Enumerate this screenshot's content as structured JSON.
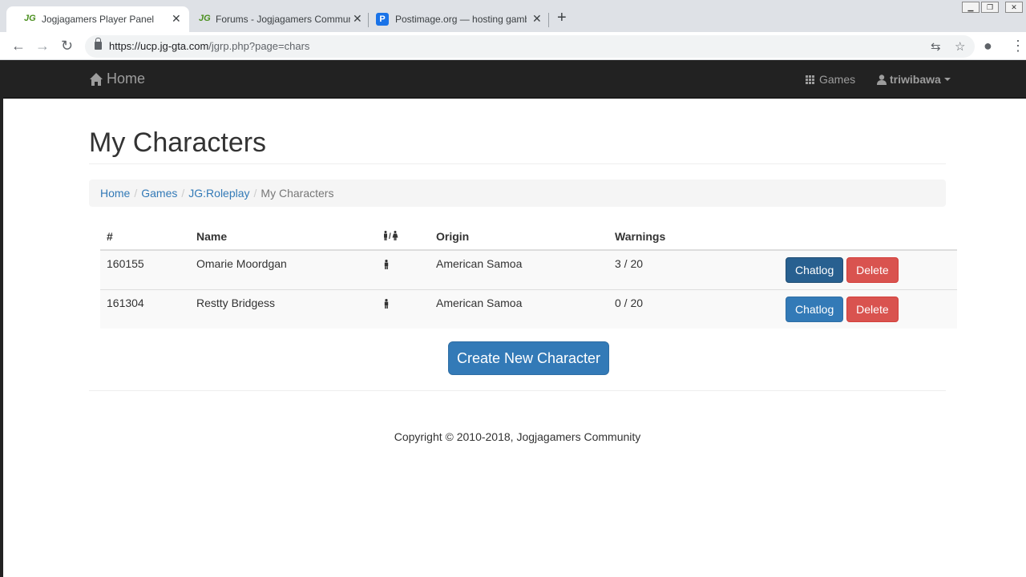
{
  "browser": {
    "tabs": [
      {
        "title": "Jogjagamers Player Panel",
        "favicon": "JG",
        "active": true
      },
      {
        "title": "Forums - Jogjagamers Communi",
        "favicon": "JG",
        "active": false
      },
      {
        "title": "Postimage.org — hosting gamba",
        "favicon": "P",
        "active": false
      }
    ],
    "url_host": "https://ucp.jg-gta.com",
    "url_path": "/jgrp.php?page=chars",
    "icons": [
      "back-arrow-icon",
      "forward-arrow-icon",
      "reload-icon",
      "translate-icon",
      "star-icon",
      "account-icon",
      "menu-icon"
    ]
  },
  "navbar": {
    "home_label": "Home",
    "games_label": "Games",
    "user_label": "triwibawa"
  },
  "page": {
    "title": "My Characters",
    "breadcrumb": [
      "Home",
      "Games",
      "JG:Roleplay",
      "My Characters"
    ]
  },
  "table": {
    "headers": {
      "id": "#",
      "name": "Name",
      "gender": "♂/♀",
      "origin": "Origin",
      "warnings": "Warnings"
    },
    "rows": [
      {
        "id": "160155",
        "name": "Omarie Moordgan",
        "gender": "male",
        "origin": "American Samoa",
        "warnings": "3 / 20"
      },
      {
        "id": "161304",
        "name": "Restty Bridgess",
        "gender": "male",
        "origin": "American Samoa",
        "warnings": "0 / 20"
      }
    ],
    "chatlog_label": "Chatlog",
    "delete_label": "Delete"
  },
  "create_button": "Create New Character",
  "footer": {
    "copyright": "Copyright © 2010-2018, Jogjagamers Community"
  },
  "colors": {
    "primary": "#337ab7",
    "danger": "#d9534f",
    "navbar": "#222222"
  }
}
